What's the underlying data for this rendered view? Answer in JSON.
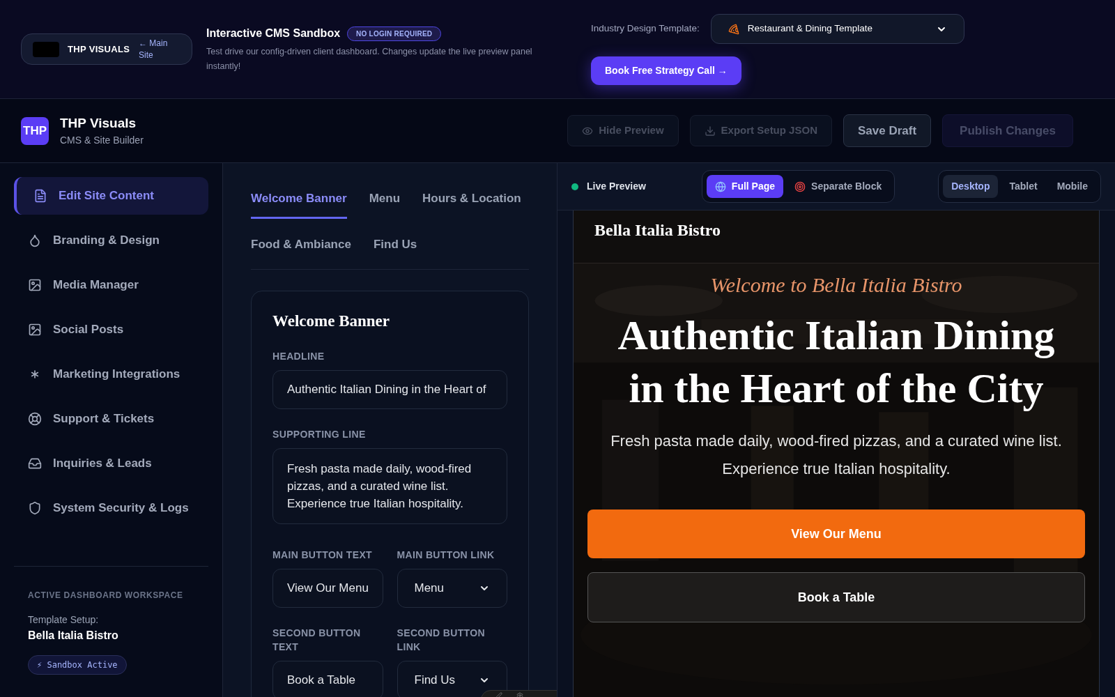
{
  "sandbox_bar": {
    "logo_text": "THP VISUALS",
    "main_site_link": "← Main Site",
    "title": "Interactive CMS Sandbox",
    "badge": "NO LOGIN REQUIRED",
    "description": "Test drive our config-driven client dashboard. Changes update the live preview panel instantly!",
    "template_label": "Industry Design Template:",
    "template_select": {
      "value": "Restaurant & Dining Template"
    },
    "cta": "Book Free Strategy Call →"
  },
  "app_header": {
    "logo": "THP",
    "title": "THP Visuals",
    "subtitle": "CMS & Site Builder",
    "buttons": [
      {
        "label": "Hide Preview",
        "kind": "eye",
        "disabled": true
      },
      {
        "label": "Export Setup JSON",
        "kind": "download",
        "disabled": true
      },
      {
        "label": "Save Draft",
        "kind": "plain",
        "disabled": false
      },
      {
        "label": "Publish Changes",
        "kind": "primary",
        "disabled": true
      }
    ]
  },
  "sidebar": {
    "items": [
      {
        "label": "Edit Site Content",
        "selected": true
      },
      {
        "label": "Branding & Design",
        "selected": false
      },
      {
        "label": "Media Manager",
        "selected": false
      },
      {
        "label": "Social Posts",
        "selected": false
      },
      {
        "label": "Marketing Integrations",
        "selected": false
      },
      {
        "label": "Support & Tickets",
        "selected": false
      },
      {
        "label": "Inquiries & Leads",
        "selected": false
      },
      {
        "label": "System Security & Logs",
        "selected": false
      }
    ],
    "workspace_heading": "ACTIVE DASHBOARD WORKSPACE",
    "template_setup_label": "Template Setup:",
    "template_name": "Bella Italia Bistro",
    "status_badge": "⚡ Sandbox Active"
  },
  "editor": {
    "tabs": [
      {
        "label": "Welcome Banner",
        "selected": true
      },
      {
        "label": "Menu",
        "selected": false
      },
      {
        "label": "Hours & Location",
        "selected": false
      },
      {
        "label": "Food & Ambiance",
        "selected": false
      },
      {
        "label": "Find Us",
        "selected": false
      }
    ],
    "card_title": "Welcome Banner",
    "fields": [
      {
        "label": "HEADLINE",
        "kind": "text",
        "value": "Authentic Italian Dining in the Heart of"
      },
      {
        "label": "SUPPORTING LINE",
        "kind": "textarea",
        "value": "Fresh pasta made daily, wood-fired pizzas, and a curated wine list. Experience true Italian hospitality."
      },
      {
        "label": "MAIN BUTTON TEXT",
        "kind": "text",
        "value": "View Our Menu"
      },
      {
        "label": "MAIN BUTTON LINK",
        "kind": "select",
        "value": "Menu"
      },
      {
        "label": "SECOND BUTTON TEXT",
        "kind": "text",
        "value": "Book a Table"
      },
      {
        "label": "SECOND BUTTON LINK",
        "kind": "select",
        "value": "Find Us"
      }
    ]
  },
  "preview": {
    "status": "Live Preview",
    "modes": [
      {
        "label": "Full Page",
        "selected": true
      },
      {
        "label": "Separate Block",
        "selected": false
      }
    ],
    "devices": [
      {
        "label": "Desktop",
        "selected": true
      },
      {
        "label": "Tablet",
        "selected": false
      },
      {
        "label": "Mobile",
        "selected": false
      }
    ],
    "site_name": "Bella Italia Bistro",
    "eyebrow": "Welcome to Bella Italia Bistro",
    "headline": "Authentic Italian Dining in the Heart of the City",
    "subtext": "Fresh pasta made daily, wood-fired pizzas, and a curated wine list. Experience true Italian hospitality.",
    "primary_button": "View Our Menu",
    "secondary_button": "Book a Table"
  }
}
